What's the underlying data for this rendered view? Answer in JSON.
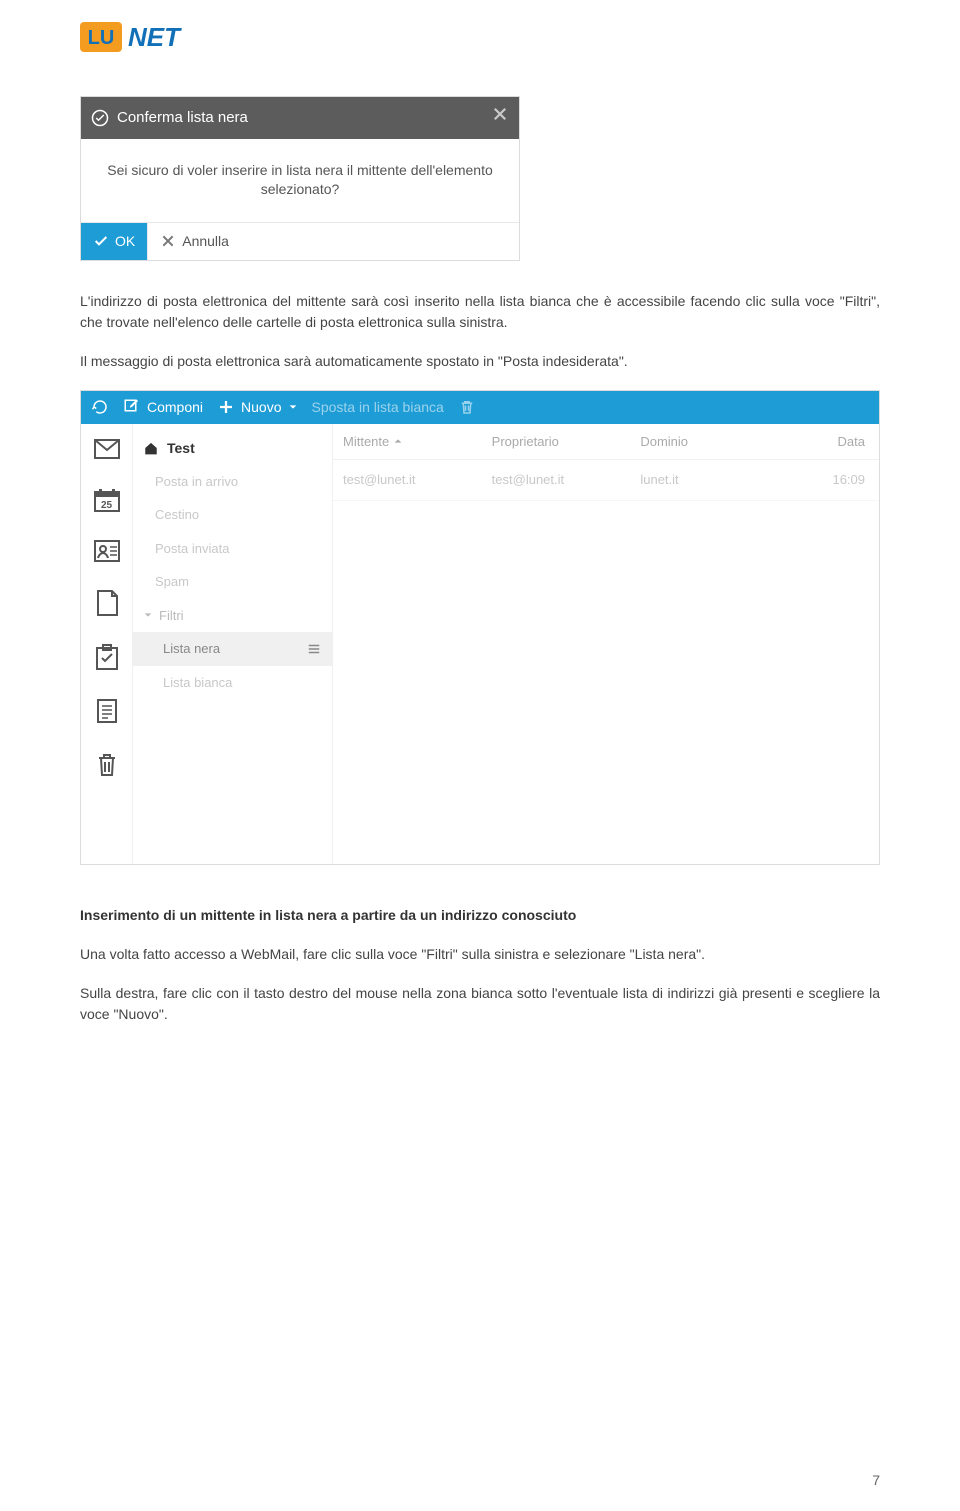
{
  "logo": {
    "text_left": "LU",
    "text_right": "NET"
  },
  "modal": {
    "title": "Conferma lista nera",
    "body": "Sei sicuro di voler inserire in lista nera il mittente dell'elemento selezionato?",
    "ok_label": "OK",
    "cancel_label": "Annulla"
  },
  "para1": "L'indirizzo di posta elettronica del mittente sarà così inserito nella lista bianca che è accessibile facendo clic sulla voce \"Filtri\", che trovate nell'elenco delle cartelle di posta elettronica sulla sinistra.",
  "para2": "Il messaggio di posta elettronica sarà automaticamente spostato in \"Posta indesiderata\".",
  "webmail": {
    "toolbar": {
      "compose": "Componi",
      "new": "Nuovo",
      "move": "Sposta in lista bianca"
    },
    "root_folder": "Test",
    "folders": [
      "Posta in arrivo",
      "Cestino",
      "Posta inviata",
      "Spam"
    ],
    "filters_label": "Filtri",
    "filter_items": [
      "Lista nera",
      "Lista bianca"
    ],
    "columns": {
      "sender": "Mittente",
      "owner": "Proprietario",
      "domain": "Dominio",
      "date": "Data"
    },
    "row": {
      "sender": "test@lunet.it",
      "owner": "test@lunet.it",
      "domain": "lunet.it",
      "date": "16:09"
    },
    "calendar_day": "25"
  },
  "subhead": "Inserimento di un mittente in lista nera a partire da un indirizzo conosciuto",
  "para3": "Una volta fatto accesso a WebMail, fare clic sulla voce \"Filtri\" sulla sinistra e selezionare \"Lista nera\".",
  "para4": "Sulla destra, fare clic con il tasto destro del mouse nella zona bianca sotto l'eventuale lista di indirizzi già presenti e scegliere la voce \"Nuovo\".",
  "page_number": "7"
}
